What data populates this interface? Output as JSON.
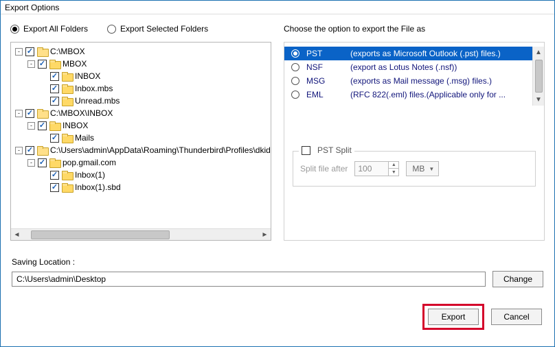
{
  "window": {
    "title": "Export Options"
  },
  "scope_radios": {
    "all": "Export All Folders",
    "selected": "Export Selected Folders",
    "value": "all"
  },
  "tree": [
    {
      "indent": 0,
      "exp": "-",
      "chk": true,
      "open": false,
      "label": "C:\\MBOX"
    },
    {
      "indent": 1,
      "exp": "-",
      "chk": true,
      "open": true,
      "label": "MBOX"
    },
    {
      "indent": 2,
      "exp": "",
      "chk": true,
      "open": true,
      "label": "INBOX"
    },
    {
      "indent": 2,
      "exp": "",
      "chk": true,
      "open": true,
      "label": "Inbox.mbs"
    },
    {
      "indent": 2,
      "exp": "",
      "chk": true,
      "open": true,
      "label": "Unread.mbs"
    },
    {
      "indent": 0,
      "exp": "-",
      "chk": true,
      "open": false,
      "label": "C:\\MBOX\\INBOX"
    },
    {
      "indent": 1,
      "exp": "-",
      "chk": true,
      "open": true,
      "label": "INBOX"
    },
    {
      "indent": 2,
      "exp": "",
      "chk": true,
      "open": true,
      "label": "Mails"
    },
    {
      "indent": 0,
      "exp": "-",
      "chk": true,
      "open": false,
      "label": "C:\\Users\\admin\\AppData\\Roaming\\Thunderbird\\Profiles\\dkid"
    },
    {
      "indent": 1,
      "exp": "-",
      "chk": true,
      "open": true,
      "label": "pop.gmail.com"
    },
    {
      "indent": 2,
      "exp": "",
      "chk": true,
      "open": true,
      "label": "Inbox(1)"
    },
    {
      "indent": 2,
      "exp": "",
      "chk": true,
      "open": true,
      "label": "Inbox(1).sbd"
    }
  ],
  "export_heading": "Choose the option to export the File as",
  "formats": [
    {
      "name": "PST",
      "desc": "(exports as Microsoft Outlook (.pst) files.)",
      "selected": true
    },
    {
      "name": "NSF",
      "desc": "(export as Lotus Notes (.nsf))",
      "selected": false
    },
    {
      "name": "MSG",
      "desc": "(exports as Mail message (.msg) files.)",
      "selected": false
    },
    {
      "name": "EML",
      "desc": "(RFC 822(.eml) files.(Applicable only for ...",
      "selected": false
    }
  ],
  "pst_split": {
    "legend": "PST Split",
    "checked": false,
    "label": "Split file after",
    "value": "100",
    "unit": "MB"
  },
  "saving": {
    "label": "Saving Location :",
    "path": "C:\\Users\\admin\\Desktop",
    "change": "Change"
  },
  "buttons": {
    "export": "Export",
    "cancel": "Cancel"
  }
}
